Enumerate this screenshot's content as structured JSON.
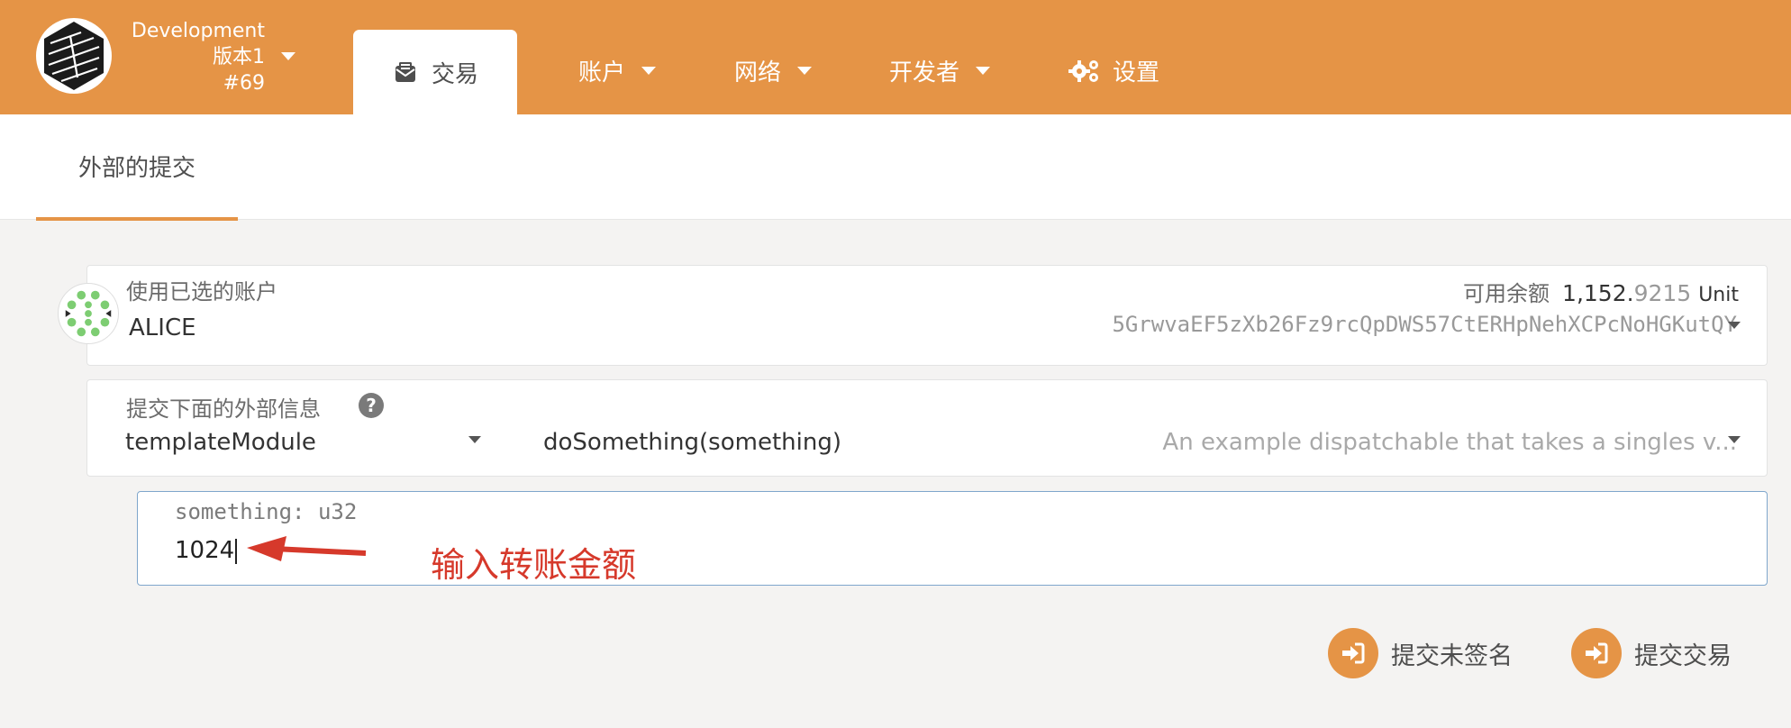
{
  "chain": {
    "name": "Development",
    "version": "版本1",
    "block": "#69"
  },
  "nav": {
    "active_tab": "交易",
    "items": [
      {
        "label": "账户",
        "icon": "none",
        "has_dropdown": true
      },
      {
        "label": "网络",
        "icon": "none",
        "has_dropdown": true
      },
      {
        "label": "开发者",
        "icon": "none",
        "has_dropdown": true
      },
      {
        "label": "设置",
        "icon": "gears-icon",
        "has_dropdown": false
      }
    ]
  },
  "subtabs": {
    "active": "外部的提交"
  },
  "account": {
    "label": "使用已选的账户",
    "name": "ALICE",
    "balance_label": "可用余额",
    "balance_main": "1,152.",
    "balance_decimal": "9215",
    "balance_unit": "Unit",
    "address": "5GrwvaEF5zXb26Fz9rcQpDWS57CtERHpNehXCPcNoHGKutQY"
  },
  "extrinsic": {
    "label": "提交下面的外部信息",
    "module": "templateModule",
    "method": "doSomething(something)",
    "description": "An example dispatchable that takes a singles v..."
  },
  "param": {
    "label": "something: u32",
    "value": "1024"
  },
  "annotation": {
    "text": "输入转账金额"
  },
  "actions": {
    "unsigned_label": "提交未签名",
    "signed_label": "提交交易"
  },
  "colors": {
    "brand": "#e59446",
    "annotation": "#d6392b",
    "focus_border": "#7fa6cc"
  }
}
